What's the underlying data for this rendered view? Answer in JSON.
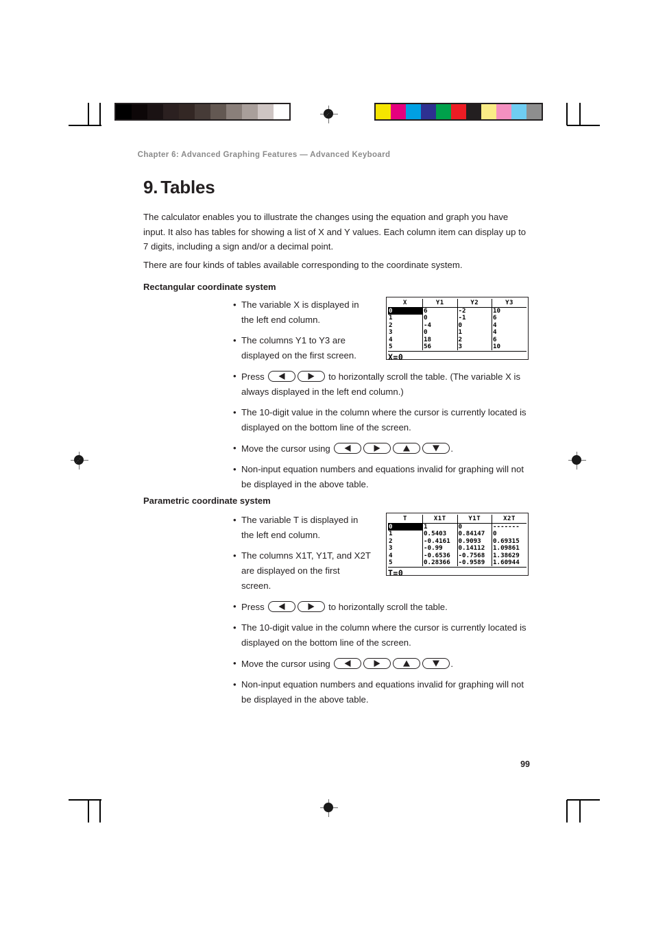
{
  "header": {
    "chapter": "Chapter 6: Advanced Graphing Features — Advanced Keyboard"
  },
  "title": {
    "number": "9.",
    "text": "Tables"
  },
  "intro": {
    "paragraph1": "The calculator enables you to illustrate the changes using the equation and graph you have input. It also has tables for showing a list of X and Y values. Each column item can display up to 7 digits, including a sign and/or a decimal point.",
    "paragraph2": "There are four kinds of tables available corresponding to the coordinate system."
  },
  "sections": {
    "rectangular": {
      "heading": "Rectangular coordinate system",
      "bullets": {
        "b1": "The variable X is displayed in the left end column.",
        "b2": "The columns Y1 to Y3 are displayed on the first screen.",
        "b3_pre": "Press",
        "b3_post": "to horizontally scroll the table. (The variable X is always displayed in the left end column.)",
        "b4": "The 10-digit value in the column where the cursor is currently located is displayed on the bottom line of the screen.",
        "b5_pre": "Move the cursor using",
        "b5_post": ".",
        "b6": "Non-input equation numbers and equations invalid for graphing will not be displayed in the above table."
      },
      "screen": {
        "columns": [
          "X",
          "Y1",
          "Y2",
          "Y3"
        ],
        "rows": [
          [
            "0",
            "6",
            "-2",
            "10"
          ],
          [
            "1",
            "0",
            "-1",
            "6"
          ],
          [
            "2",
            "-4",
            "0",
            "4"
          ],
          [
            "3",
            "0",
            "1",
            "4"
          ],
          [
            "4",
            "18",
            "2",
            "6"
          ],
          [
            "5",
            "56",
            "3",
            "10"
          ]
        ],
        "selected_cell": [
          0,
          0
        ],
        "status": "X=0"
      }
    },
    "parametric": {
      "heading": "Parametric coordinate system",
      "bullets": {
        "b1": "The variable T is displayed in the left end column.",
        "b2": "The columns X1T, Y1T, and X2T are displayed on the first screen.",
        "b3_pre": "Press",
        "b3_post": "to horizontally scroll the table.",
        "b4": "The 10-digit value in the column where the cursor is currently located is displayed on the bottom line of the screen.",
        "b5_pre": "Move the cursor using",
        "b5_post": ".",
        "b6": "Non-input equation numbers and equations invalid for graphing will not be displayed in the above table."
      },
      "screen": {
        "columns": [
          "T",
          "X1T",
          "Y1T",
          "X2T"
        ],
        "rows": [
          [
            "0",
            "1",
            "0",
            "-------"
          ],
          [
            "1",
            "0.5403",
            "0.84147",
            "0"
          ],
          [
            "2",
            "-0.4161",
            "0.9093",
            "0.69315"
          ],
          [
            "3",
            "-0.99",
            "0.14112",
            "1.09861"
          ],
          [
            "4",
            "-0.6536",
            "-0.7568",
            "1.38629"
          ],
          [
            "5",
            "0.28366",
            "-0.9589",
            "1.60944"
          ]
        ],
        "selected_cell": [
          0,
          0
        ],
        "status": "T=0"
      }
    }
  },
  "footer": {
    "page_number": "99"
  },
  "print_marks": {
    "grayscale_swatches": [
      "#000000",
      "#0d0708",
      "#1a1213",
      "#2b2020",
      "#332724",
      "#463b37",
      "#635852",
      "#8a7f7a",
      "#a99f9b",
      "#cec5c3",
      "#ffffff"
    ],
    "color_swatches": [
      "#f6e500",
      "#e6007e",
      "#00a0e3",
      "#2e3191",
      "#00a14b",
      "#ed1c24",
      "#231f20",
      "#faec86",
      "#f490c0",
      "#6fcdf2",
      "#8e8e8e"
    ]
  }
}
